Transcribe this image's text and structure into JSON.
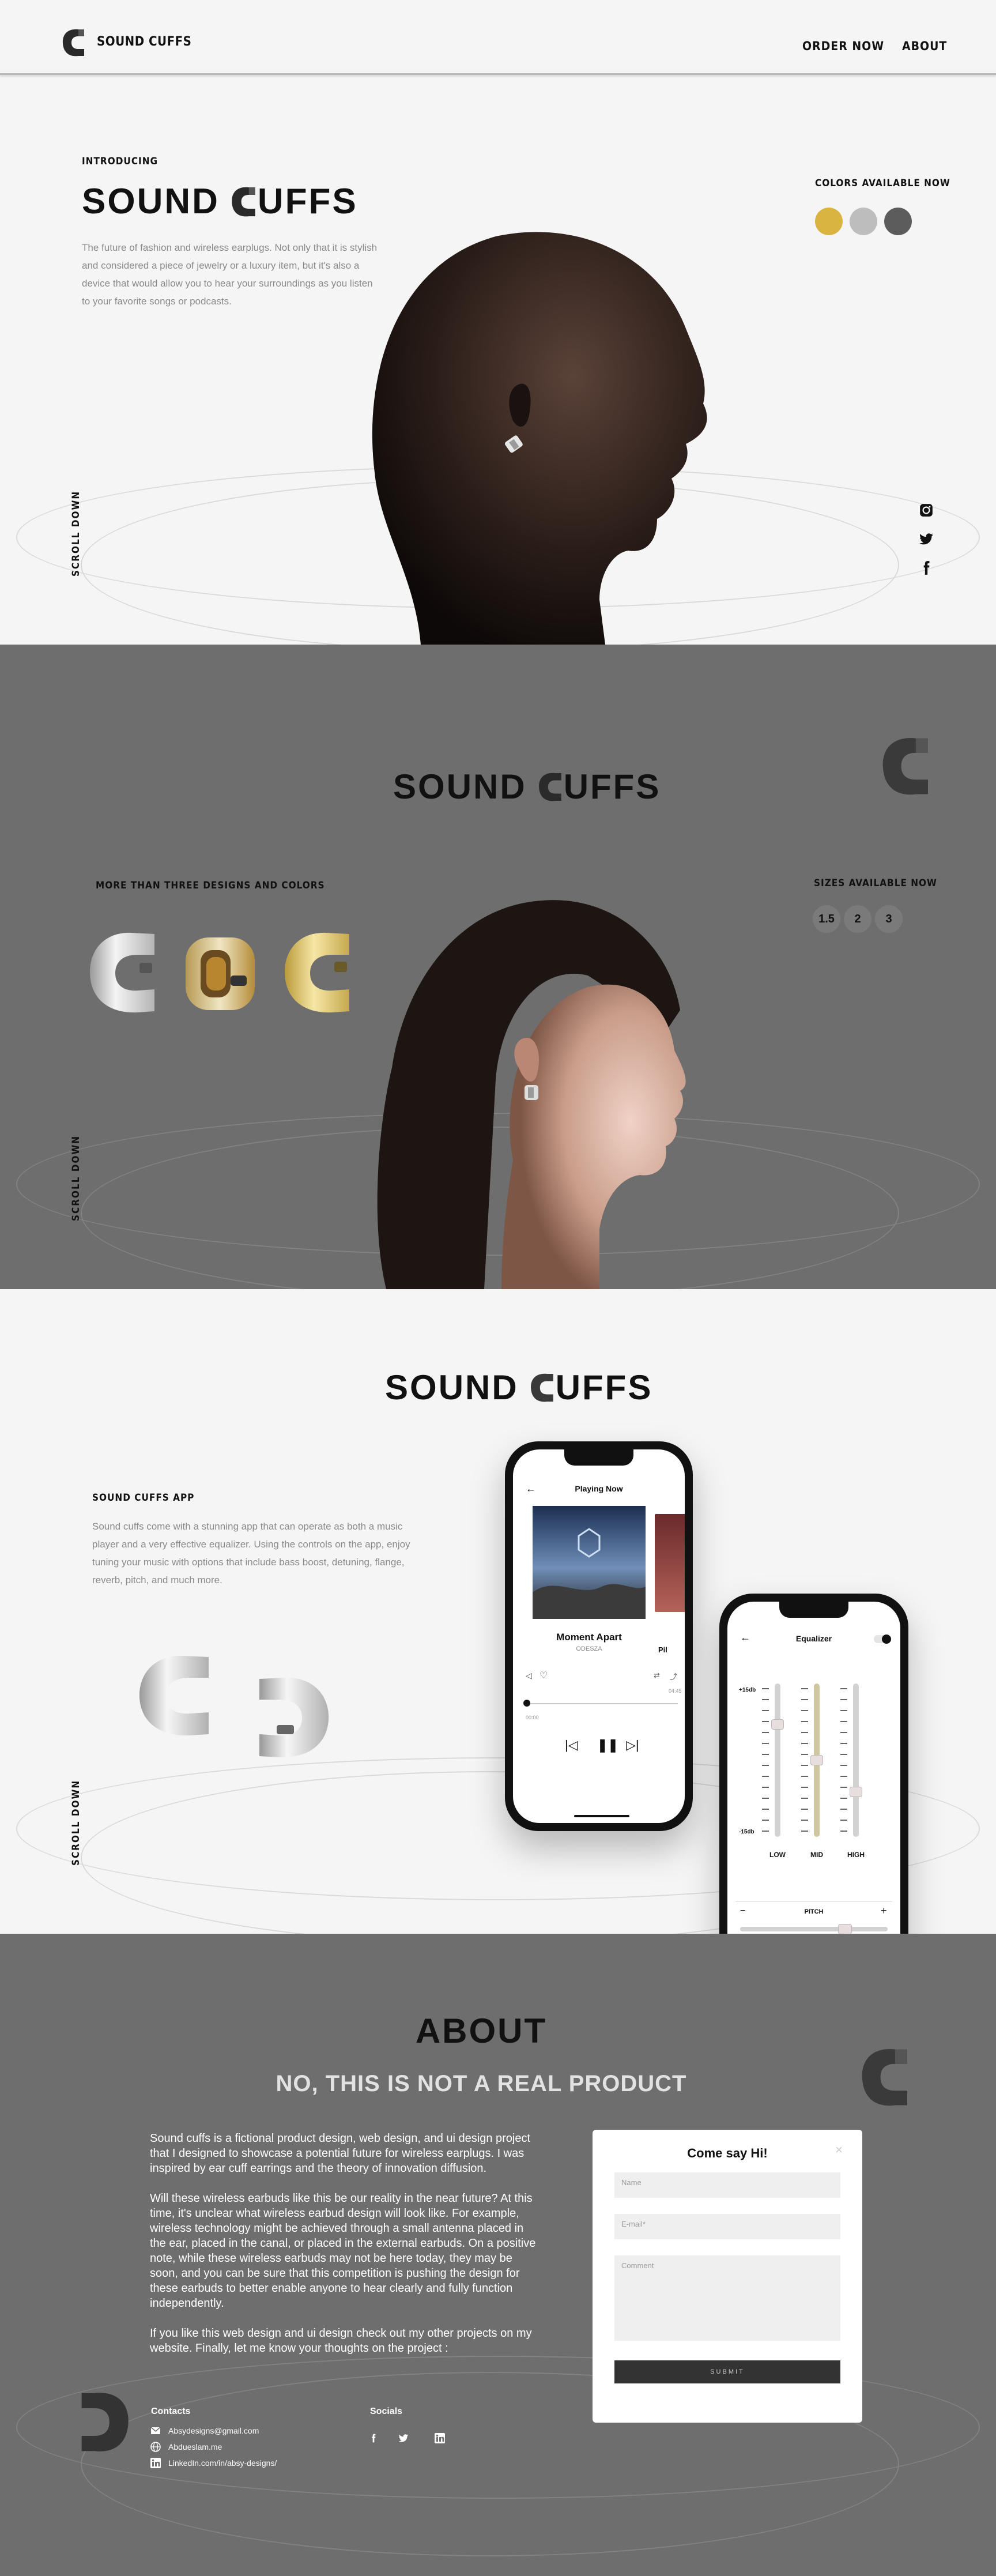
{
  "header": {
    "brand": "SOUND CUFFS",
    "nav": [
      "ORDER NOW",
      "ABOUT"
    ]
  },
  "hero": {
    "eyebrow": "INTRODUCING",
    "title_left": "SOUND",
    "title_right": "UFFS",
    "description": "The future of fashion and wireless earplugs. Not only that it is stylish and considered a piece of jewelry or a luxury item, but it's also a device that would allow you to hear your surroundings as you listen to your favorite songs or podcasts.",
    "colors_label": "COLORS AVAILABLE NOW",
    "colors": [
      "#d9b440",
      "#bdbdbd",
      "#5c5c5c"
    ],
    "scroll_label": "SCROLL DOWN",
    "socials": [
      "instagram-icon",
      "twitter-icon",
      "facebook-icon"
    ]
  },
  "designs": {
    "title_left": "SOUND",
    "title_right": "UFFS",
    "designs_label": "MORE THAN THREE DESIGNS AND COLORS",
    "sizes_label": "SIZES AVAILABLE NOW",
    "sizes": [
      "1.5",
      "2",
      "3"
    ],
    "scroll_label": "SCROLL DOWN"
  },
  "app": {
    "title_left": "SOUND",
    "title_right": "UFFS",
    "app_title": "SOUND CUFFS APP",
    "description": "Sound cuffs come with a stunning app that can operate as both a music player and a very effective equalizer. Using the controls on the app, enjoy tuning your music with options that include bass boost, detuning, flange, reverb, pitch, and much more.",
    "scroll_label": "SCROLL DOWN",
    "player": {
      "header": "Playing Now",
      "track": "Moment Apart",
      "artist": "ODESZA",
      "time_start": "00:00",
      "time_end": "04:45",
      "side_label": "Pil"
    },
    "equalizer": {
      "header": "Equalizer",
      "top_db": "+15db",
      "bottom_db": "-15db",
      "bands": [
        "LOW",
        "MID",
        "HIGH"
      ],
      "band_levels": [
        0.25,
        0.5,
        0.72
      ],
      "pitch_label": "PITCH",
      "minus": "−",
      "plus": "+"
    }
  },
  "about": {
    "title": "ABOUT",
    "subtitle": "NO, THIS IS NOT A REAL PRODUCT",
    "paragraphs": [
      "Sound cuffs is a fictional product design, web design, and ui design project that I designed to showcase a potential future for wireless earplugs. I was inspired by ear cuff earrings and the theory of innovation diffusion.",
      "Will these wireless earbuds like this be our reality in the near future? At this time, it's unclear what wireless earbud design will look like. For example, wireless technology might be achieved through a small antenna placed in the ear, placed in the canal, or placed in the external earbuds. On a positive note, while these wireless earbuds may not be here today, they may be soon, and you can be sure that this competition is pushing the design for these earbuds to better enable anyone to hear clearly and fully function independently.",
      "If you like this web design and ui design check out my other projects on my website. Finally, let me know your thoughts on the project :"
    ],
    "contacts_label": "Contacts",
    "contacts": [
      {
        "icon": "mail-icon",
        "text": "Absydesigns@gmail.com"
      },
      {
        "icon": "globe-icon",
        "text": "Abdueslam.me"
      },
      {
        "icon": "linkedin-icon",
        "text": "LinkedIn.com/in/absy-designs/"
      }
    ],
    "socials_label": "Socials",
    "socials": [
      "facebook-icon",
      "twitter-icon",
      "linkedin-icon"
    ],
    "form": {
      "title": "Come say Hi!",
      "close": "×",
      "name_placeholder": "Name",
      "email_placeholder": "E-mail*",
      "comment_placeholder": "Comment",
      "submit": "SUBMIT"
    }
  }
}
